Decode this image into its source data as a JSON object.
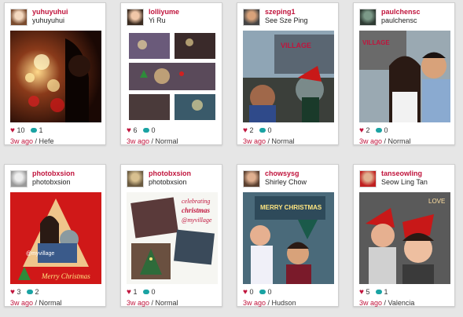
{
  "colors": {
    "username": "#c0143c",
    "comment_bubble": "#1aa3a3",
    "time": "#c0143c"
  },
  "cards": [
    {
      "username": "yuhuyuhui",
      "fullname": "yuhuyuhui",
      "likes": "10",
      "comments": "1",
      "time": "3w ago",
      "filter": "Hefe"
    },
    {
      "username": "lolliyume",
      "fullname": "Yi Ru",
      "likes": "6",
      "comments": "0",
      "time": "3w ago",
      "filter": "Normal"
    },
    {
      "username": "szeping1",
      "fullname": "See Sze Ping",
      "likes": "2",
      "comments": "0",
      "time": "3w ago",
      "filter": "Normal"
    },
    {
      "username": "paulchensc",
      "fullname": "paulchensc",
      "likes": "2",
      "comments": "0",
      "time": "3w ago",
      "filter": "Normal"
    },
    {
      "username": "photobxsion",
      "fullname": "photobxsion",
      "likes": "3",
      "comments": "2",
      "time": "3w ago",
      "filter": "Normal"
    },
    {
      "username": "photobxsion",
      "fullname": "photobxsion",
      "likes": "1",
      "comments": "0",
      "time": "3w ago",
      "filter": "Normal"
    },
    {
      "username": "chowsysg",
      "fullname": "Shirley Chow",
      "likes": "0",
      "comments": "0",
      "time": "3w ago",
      "filter": "Hudson"
    },
    {
      "username": "tanseowling",
      "fullname": "Seow Ling Tan",
      "likes": "5",
      "comments": "1",
      "time": "3w ago",
      "filter": "Valencia"
    }
  ],
  "photo_text": {
    "card3_sign": "VILLAGE",
    "card4_sign": "VILLAGE",
    "card5_caption": "Merry Christmas",
    "card5_tag": "@myvillage",
    "card6_line1": "celebrating",
    "card6_line2": "christmas",
    "card6_line3": "@myvillage",
    "card7_sign": "MERRY CHRISTMAS",
    "card8_sign": "LOVE"
  }
}
